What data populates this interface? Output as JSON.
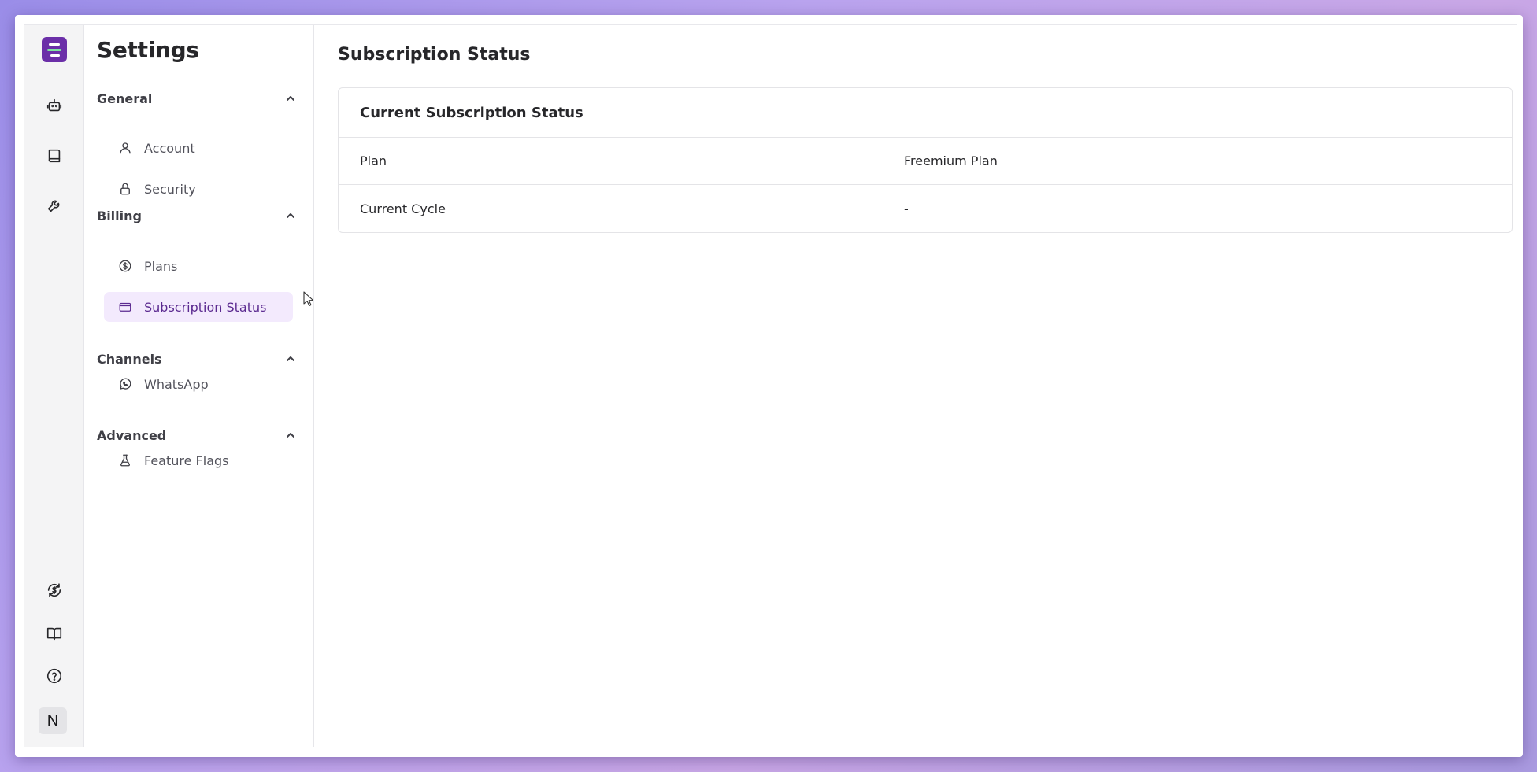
{
  "sidebar": {
    "title": "Settings",
    "groups": [
      {
        "label": "General",
        "items": [
          {
            "label": "Account",
            "icon": "user-icon"
          },
          {
            "label": "Security",
            "icon": "lock-icon"
          }
        ]
      },
      {
        "label": "Billing",
        "items": [
          {
            "label": "Plans",
            "icon": "dollar-circle-icon"
          },
          {
            "label": "Subscription Status",
            "icon": "credit-card-icon",
            "active": true
          }
        ]
      },
      {
        "label": "Channels",
        "items": [
          {
            "label": "WhatsApp",
            "icon": "whatsapp-icon"
          }
        ]
      },
      {
        "label": "Advanced",
        "items": [
          {
            "label": "Feature Flags",
            "icon": "flask-icon"
          }
        ]
      }
    ]
  },
  "rail": {
    "avatar_initial": "N",
    "icons": [
      "app-logo-icon",
      "bot-icon",
      "book-icon",
      "wrench-icon",
      "billing-refresh-icon",
      "docs-book-icon",
      "help-icon"
    ]
  },
  "main": {
    "title": "Subscription Status",
    "card": {
      "title": "Current Subscription Status",
      "rows": [
        {
          "label": "Plan",
          "value": "Freemium Plan"
        },
        {
          "label": "Current Cycle",
          "value": "-"
        }
      ]
    }
  },
  "colors": {
    "accent": "#6b2fa8",
    "active_bg": "#f3eafd",
    "active_text": "#5b2a90"
  }
}
